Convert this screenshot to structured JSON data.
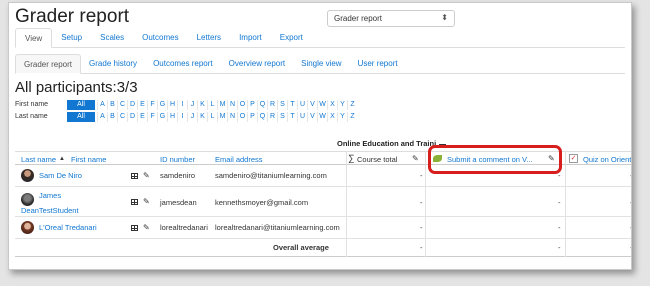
{
  "page": {
    "title": "Grader report",
    "report_select": "Grader report",
    "main_tabs": [
      "View",
      "Setup",
      "Scales",
      "Outcomes",
      "Letters",
      "Import",
      "Export"
    ],
    "sub_tabs": [
      "Grader report",
      "Grade history",
      "Outcomes report",
      "Overview report",
      "Single view",
      "User report"
    ],
    "participants_heading": "All participants:3/3",
    "first_name_label": "First name",
    "last_name_label": "Last name",
    "all_label": "All",
    "letters": [
      "A",
      "B",
      "C",
      "D",
      "E",
      "F",
      "G",
      "H",
      "I",
      "J",
      "K",
      "L",
      "M",
      "N",
      "O",
      "P",
      "Q",
      "R",
      "S",
      "T",
      "U",
      "V",
      "W",
      "X",
      "Y",
      "Z"
    ]
  },
  "table": {
    "category": "Online Education and Traini",
    "headers": {
      "last_name": "Last name",
      "sort_arrow": "▲",
      "first_name": "First name",
      "id_number": "ID number",
      "email": "Email address",
      "course_total": "Course total",
      "assignment": "Submit a comment on V...",
      "quiz": "Quiz on Orientation"
    },
    "rows": [
      {
        "name": "Sam De Niro",
        "id": "samdeniro",
        "email": "samdeniro@titaniumlearning.com",
        "total": "-",
        "assign": "-",
        "quiz": "-"
      },
      {
        "name_line1": "James",
        "name_line2": "DeanTestStudent",
        "id": "jamesdean",
        "email": "kennethsmoyer@gmail.com",
        "total": "-",
        "assign": "-",
        "quiz": "-"
      },
      {
        "name": "L'Oreal Tredanari",
        "id": "lorealtredanari",
        "email": "lorealtredanari@titaniumlearning.com",
        "total": "-",
        "assign": "-",
        "quiz": "-"
      }
    ],
    "overall_average": "Overall average",
    "avg_total": "-",
    "avg_assign": "-",
    "avg_quiz": "-"
  }
}
